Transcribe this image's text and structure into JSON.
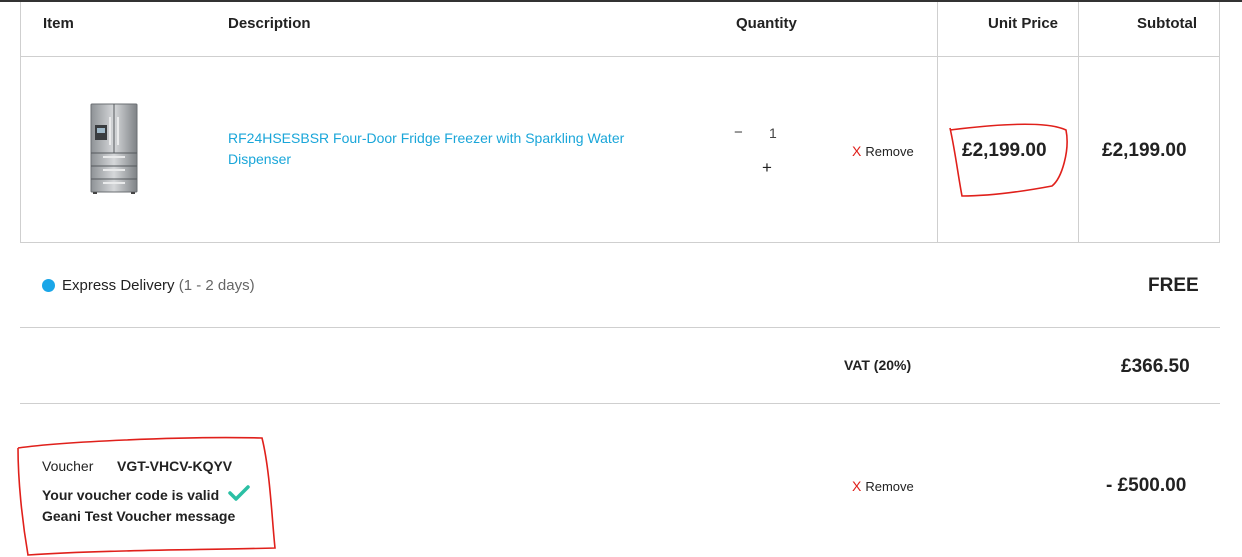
{
  "table": {
    "headers": {
      "item": "Item",
      "description": "Description",
      "quantity": "Quantity",
      "unit_price": "Unit Price",
      "subtotal": "Subtotal"
    }
  },
  "product": {
    "name_line1": "RF24HSESBSR Four-Door Fridge Freezer with Sparkling Water",
    "name_line2": "Dispenser",
    "quantity": "1",
    "decrement": "−",
    "increment": "+",
    "remove_x": "X",
    "remove_label": "Remove",
    "unit_price": "£2,199.00",
    "subtotal": "£2,199.00"
  },
  "delivery": {
    "label": "Express Delivery",
    "duration": "(1 - 2 days)",
    "price": "FREE",
    "dot_color": "#1aa6e8"
  },
  "vat": {
    "label": "VAT (20%)",
    "amount": "£366.50"
  },
  "voucher": {
    "label": "Voucher",
    "code": "VGT-VHCV-KQYV",
    "valid_message": "Your voucher code is valid",
    "custom_message": "Geani Test Voucher message",
    "remove_x": "X",
    "remove_label": "Remove",
    "amount": "- £500.00",
    "check_color": "#2bbfa4"
  },
  "annotations": {
    "color": "#e0201b"
  }
}
